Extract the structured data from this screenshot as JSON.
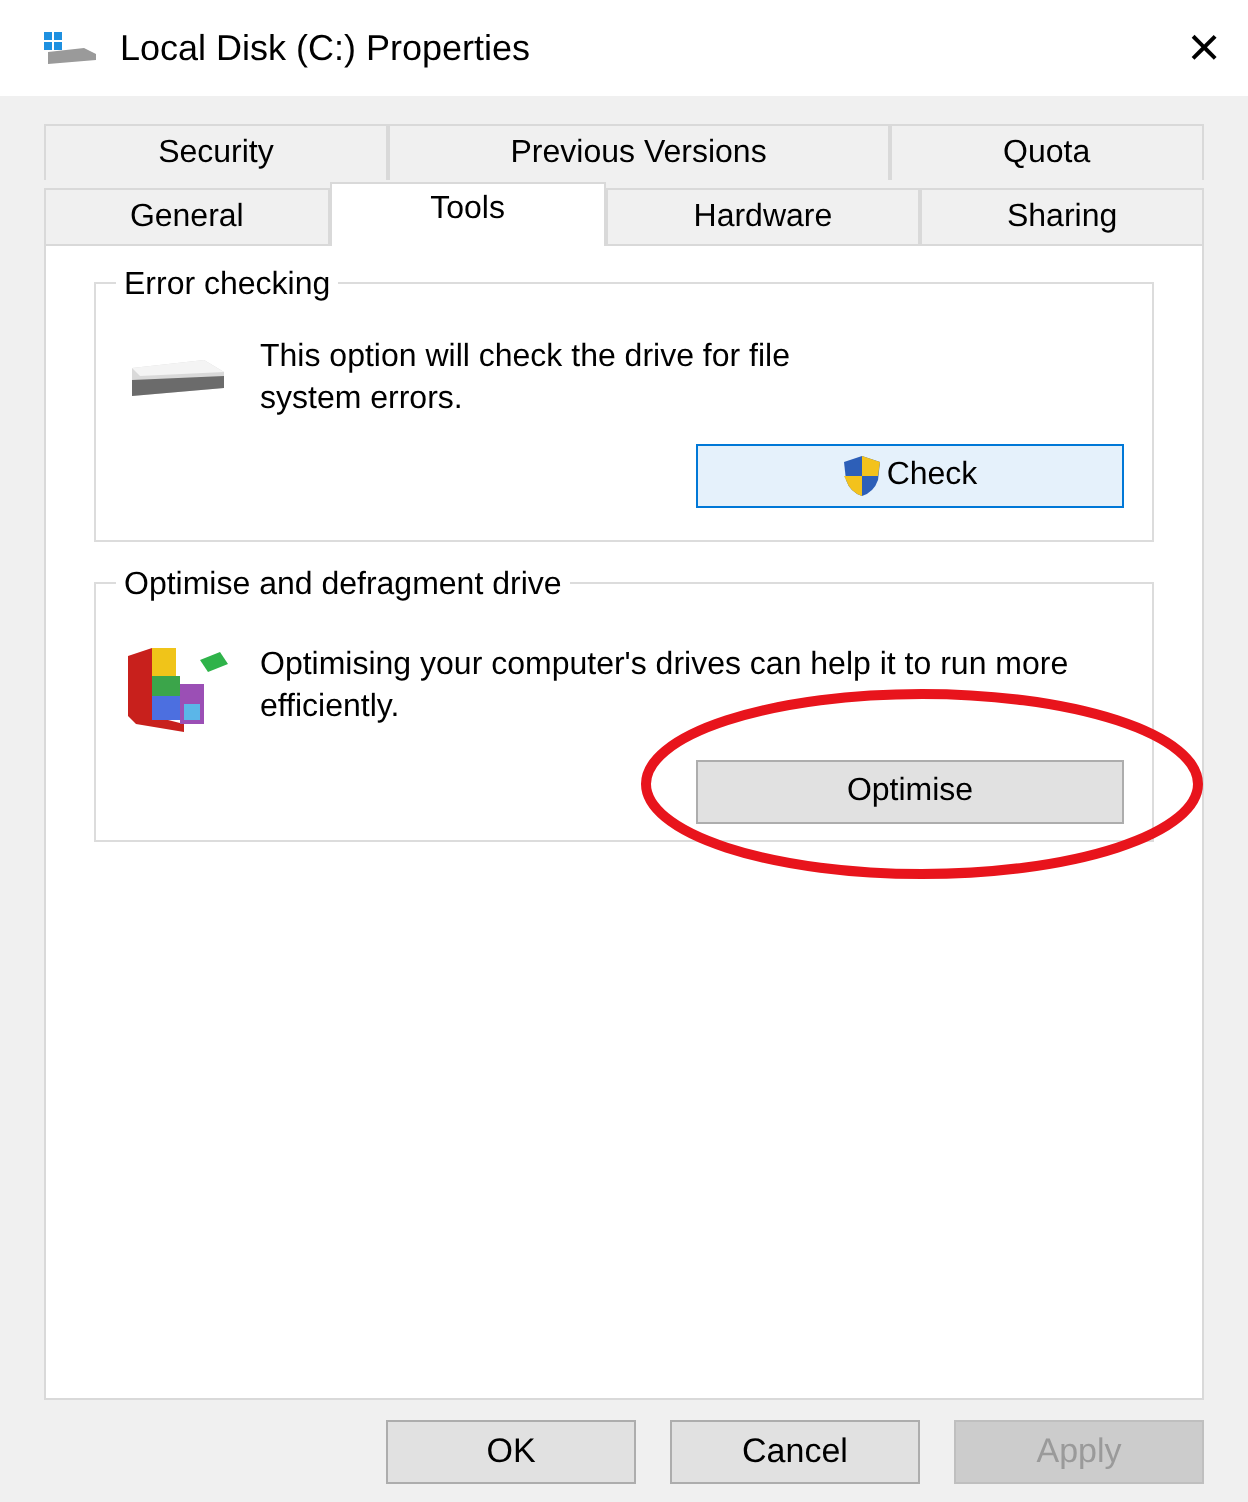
{
  "window": {
    "title": "Local Disk (C:) Properties",
    "close": "×"
  },
  "tab_rows": [
    [
      {
        "label": "Security",
        "selected": false
      },
      {
        "label": "Previous Versions",
        "selected": false
      },
      {
        "label": "Quota",
        "selected": false
      }
    ],
    [
      {
        "label": "General",
        "selected": false
      },
      {
        "label": "Tools",
        "selected": true
      },
      {
        "label": "Hardware",
        "selected": false
      },
      {
        "label": "Sharing",
        "selected": false
      }
    ]
  ],
  "groups": [
    {
      "title": "Error checking",
      "kind": "drive",
      "text": "This option will check the drive for file system errors.",
      "button": {
        "label": "Check",
        "focused": true,
        "shield": true
      }
    },
    {
      "title": "Optimise and defragment drive",
      "kind": "defrag",
      "text": "Optimising your computer's drives can help it to run more efficiently.",
      "button": {
        "label": "Optimise",
        "focused": false,
        "shield": false
      }
    }
  ],
  "annotation": {
    "kind": "ellipse",
    "color": "#e8141c"
  },
  "buttons": [
    {
      "label": "OK",
      "disabled": false
    },
    {
      "label": "Cancel",
      "disabled": false
    },
    {
      "label": "Apply",
      "disabled": true
    }
  ]
}
